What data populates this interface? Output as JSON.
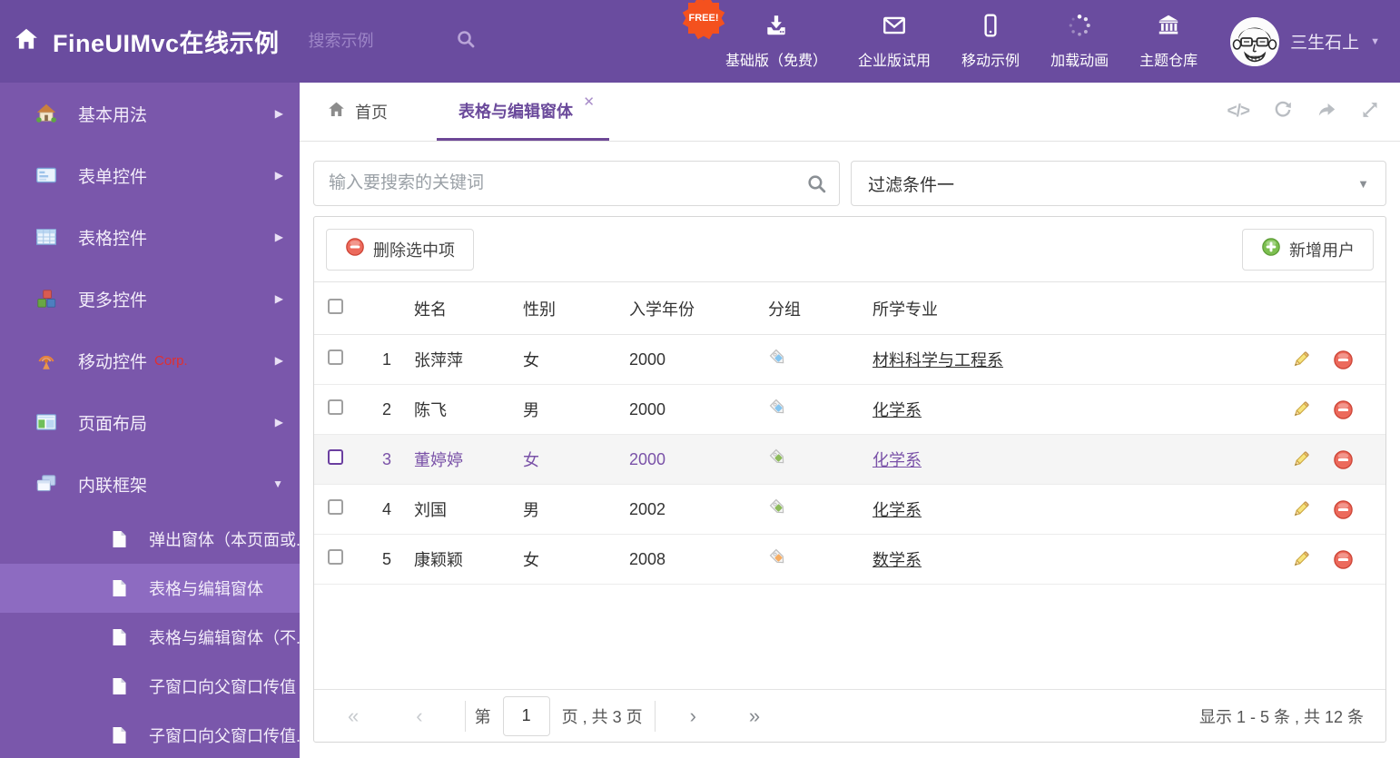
{
  "header": {
    "logo_text": "FineUIMvc在线示例",
    "search_placeholder": "搜索示例",
    "free_badge": "FREE!",
    "nav": [
      {
        "label": "基础版（免费）",
        "icon": "download-icon"
      },
      {
        "label": "企业版试用",
        "icon": "mail-icon"
      },
      {
        "label": "移动示例",
        "icon": "mobile-icon"
      },
      {
        "label": "加载动画",
        "icon": "spinner-icon"
      },
      {
        "label": "主题仓库",
        "icon": "bank-icon"
      }
    ],
    "username": "三生石上"
  },
  "sidebar": {
    "items": [
      {
        "label": "基本用法",
        "icon": "home-icon"
      },
      {
        "label": "表单控件",
        "icon": "form-icon"
      },
      {
        "label": "表格控件",
        "icon": "table-icon"
      },
      {
        "label": "更多控件",
        "icon": "cubes-icon"
      },
      {
        "label": "移动控件",
        "badge": "Corp.",
        "icon": "antenna-icon"
      },
      {
        "label": "页面布局",
        "icon": "layout-icon"
      },
      {
        "label": "内联框架",
        "icon": "frames-icon"
      }
    ],
    "subitems": [
      {
        "label": "弹出窗体（本页面或..."
      },
      {
        "label": "表格与编辑窗体"
      },
      {
        "label": "表格与编辑窗体（不..."
      },
      {
        "label": "子窗口向父窗口传值"
      },
      {
        "label": "子窗口向父窗口传值..."
      }
    ]
  },
  "tabs": {
    "home": "首页",
    "active": "表格与编辑窗体"
  },
  "filter": {
    "search_placeholder": "输入要搜索的关键词",
    "dropdown_value": "过滤条件一"
  },
  "grid": {
    "delete_button": "删除选中项",
    "add_button": "新增用户",
    "columns": {
      "name": "姓名",
      "gender": "性别",
      "year": "入学年份",
      "group": "分组",
      "major": "所学专业"
    },
    "rows": [
      {
        "num": "1",
        "name": "张萍萍",
        "gender": "女",
        "year": "2000",
        "tag": "blue",
        "major": "材料科学与工程系"
      },
      {
        "num": "2",
        "name": "陈飞",
        "gender": "男",
        "year": "2000",
        "tag": "blue",
        "major": "化学系"
      },
      {
        "num": "3",
        "name": "董婷婷",
        "gender": "女",
        "year": "2000",
        "tag": "green",
        "major": "化学系"
      },
      {
        "num": "4",
        "name": "刘国",
        "gender": "男",
        "year": "2002",
        "tag": "green",
        "major": "化学系"
      },
      {
        "num": "5",
        "name": "康颖颖",
        "gender": "女",
        "year": "2008",
        "tag": "orange",
        "major": "数学系"
      }
    ]
  },
  "pagination": {
    "page_label_prefix": "第",
    "page_value": "1",
    "page_label_suffix": "页 , 共 3 页",
    "summary": "显示 1 - 5 条 , 共 12 条"
  },
  "colors": {
    "header_bg": "#6A4C9F",
    "sidebar_bg": "#7A57AB",
    "sidebar_selected_bg": "#8D6BC1",
    "accent_purple": "#6D4796",
    "free_badge_bg": "#F4511E",
    "tag_blue": "#85C5F0",
    "tag_green": "#8CBA5A",
    "tag_orange": "#F6AC62",
    "delete_red": "#EC6A5C",
    "add_green": "#7CBF4F"
  }
}
